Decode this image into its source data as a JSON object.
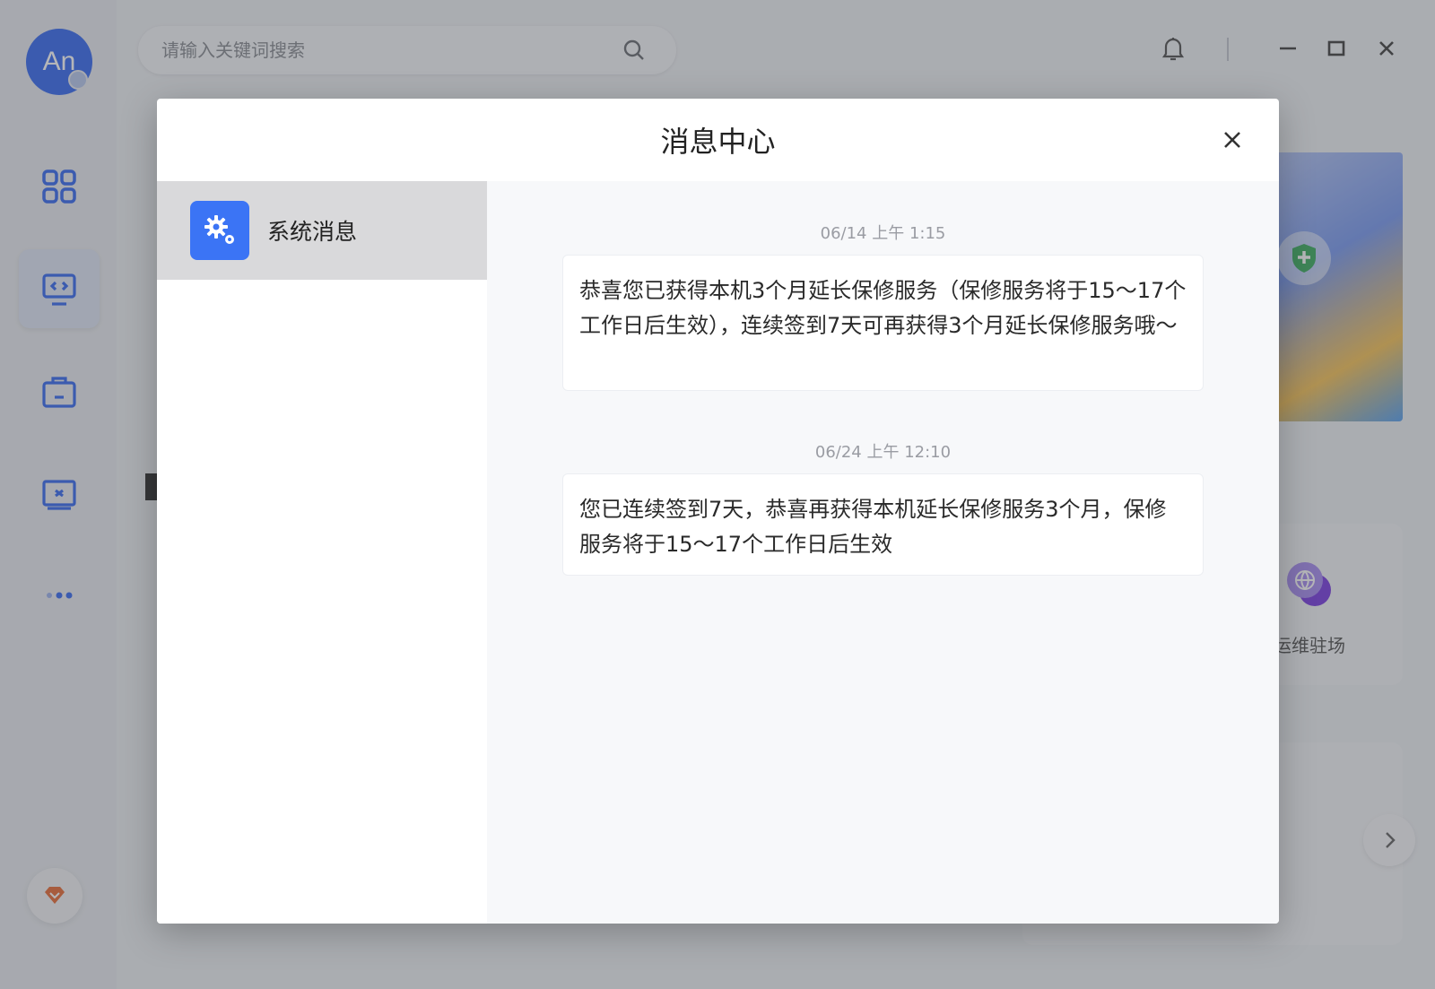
{
  "app": {
    "avatar_text": "An",
    "search": {
      "placeholder": "请输入关键词搜索",
      "value": ""
    },
    "bg_card_label": "运维驻场",
    "nav_items": [
      "apps-grid-icon",
      "remote-desktop-icon",
      "briefcase-icon",
      "screen-icon",
      "more-icon"
    ],
    "accent_color": "#3b74f5"
  },
  "modal": {
    "title": "消息中心",
    "categories": [
      {
        "label": "系统消息",
        "icon": "gear-icon",
        "selected": true
      }
    ],
    "messages": [
      {
        "time": "06/14 上午 1:15",
        "text": "恭喜您已获得本机3个月延长保修服务（保修服务将于15～17个工作日后生效），连续签到7天可再获得3个月延长保修服务哦～"
      },
      {
        "time": "06/24 上午 12:10",
        "text": "您已连续签到7天，恭喜再获得本机延长保修服务3个月，保修服务将于15～17个工作日后生效"
      }
    ]
  }
}
